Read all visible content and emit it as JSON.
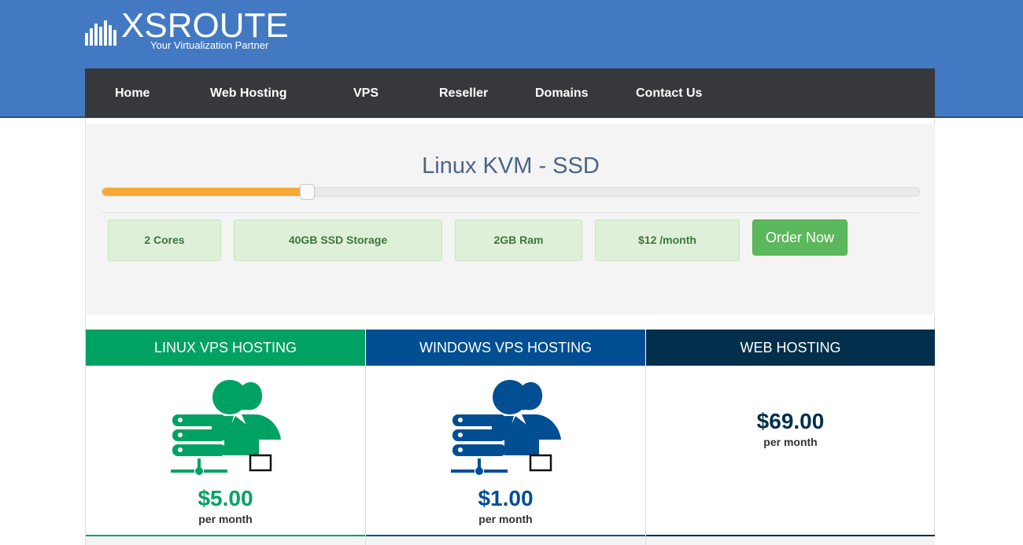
{
  "brand": {
    "name": "XSROUTE",
    "tagline": "Your Virtualization Partner"
  },
  "nav": {
    "items": [
      {
        "label": "Home"
      },
      {
        "label": "Web Hosting"
      },
      {
        "label": "VPS"
      },
      {
        "label": "Reseller"
      },
      {
        "label": "Domains"
      },
      {
        "label": "Contact Us"
      }
    ]
  },
  "configurator": {
    "title": "Linux KVM - SSD",
    "slider_fraction": 0.25,
    "specs": [
      {
        "label": "2 Cores"
      },
      {
        "label": "40GB SSD Storage"
      },
      {
        "label": "2GB Ram"
      },
      {
        "label": "$12 /month"
      }
    ],
    "order_label": "Order Now"
  },
  "plans": [
    {
      "tab": "LINUX VPS HOSTING",
      "price": "$5.00",
      "per": "per month",
      "icon": "vps-server-users-icon"
    },
    {
      "tab": "WINDOWS VPS HOSTING",
      "price": "$1.00",
      "per": "per month",
      "icon": "vps-server-users-icon"
    },
    {
      "tab": "WEB HOSTING",
      "price": "$69.00",
      "per": "per month",
      "icon": ""
    }
  ],
  "colors": {
    "header": "#4379c3",
    "nav": "#37383b",
    "slider_fill": "#f6aa33",
    "order_button": "#5cb85c",
    "spec_box": "#dff0d8",
    "spec_text": "#3c763d",
    "linux_tab": "#00a263",
    "windows_tab": "#014f92",
    "web_tab": "#022f4b"
  }
}
